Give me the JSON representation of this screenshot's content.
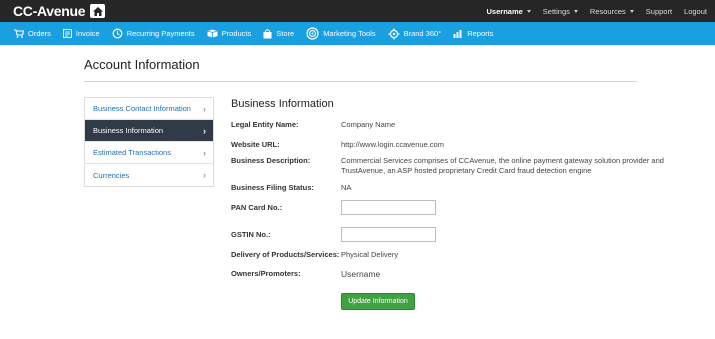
{
  "topbar": {
    "logo": "CC-Avenue",
    "nav": [
      {
        "label": "Username",
        "dropdown": true
      },
      {
        "label": "Settings",
        "dropdown": true
      },
      {
        "label": "Resources",
        "dropdown": true
      },
      {
        "label": "Support",
        "dropdown": false
      },
      {
        "label": "Logout",
        "dropdown": false
      }
    ]
  },
  "mainnav": {
    "items": [
      {
        "label": "Orders",
        "icon": "cart-icon"
      },
      {
        "label": "Invoice",
        "icon": "invoice-icon"
      },
      {
        "label": "Recurring Payments",
        "icon": "recurring-icon"
      },
      {
        "label": "Products",
        "icon": "products-icon"
      },
      {
        "label": "Store",
        "icon": "store-icon"
      },
      {
        "label": "Marketing Tools",
        "icon": "target-icon"
      },
      {
        "label": "Brand 360°",
        "icon": "brand-icon"
      },
      {
        "label": "Reports",
        "icon": "chart-icon"
      }
    ]
  },
  "page": {
    "title": "Account Information"
  },
  "leftmenu": {
    "items": [
      {
        "label": "Business Contact Information",
        "active": false
      },
      {
        "label": "Business Information",
        "active": true
      },
      {
        "label": "Estimated Transactions",
        "active": false
      },
      {
        "label": "Currencies",
        "active": false
      }
    ]
  },
  "form": {
    "section_title": "Business Information",
    "legal_entity": {
      "label": "Legal Entity Name:",
      "value": "Company Name"
    },
    "website": {
      "label": "Website URL:",
      "value": "http://www.login.ccavenue.com"
    },
    "description": {
      "label": "Business Description:",
      "value": "Commercial Services comprises of CCAvenue, the online payment gateway solution provider and TrustAvenue, an ASP hosted proprietary Credit Card fraud detection engine"
    },
    "filing_status": {
      "label": "Business Filing Status:",
      "value": "NA"
    },
    "pan": {
      "label": "PAN Card No.:",
      "value": ""
    },
    "gstin": {
      "label": "GSTIN No.:",
      "value": ""
    },
    "delivery": {
      "label": "Delivery of Products/Services:",
      "value": "Physical Delivery"
    },
    "owners": {
      "label": "Owners/Promoters:",
      "value": "Username"
    },
    "update_button": "Update Information"
  },
  "colors": {
    "topbar": "#262626",
    "mainnav": "#1a9fe0",
    "active_menu": "#313b48",
    "link": "#1f6fb5",
    "button": "#3fa142"
  }
}
